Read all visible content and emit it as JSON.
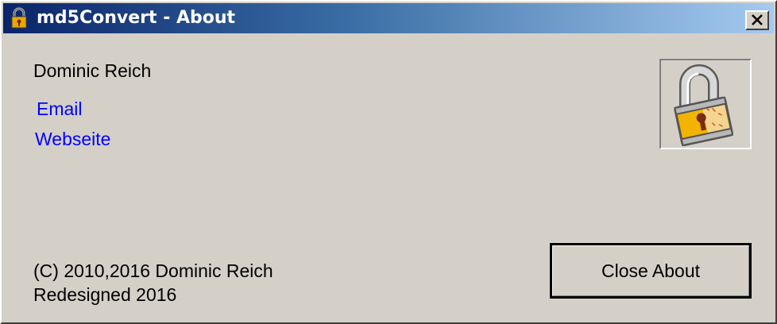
{
  "window": {
    "title": "md5Convert - About",
    "titlebar_gradient": [
      "#0a246a",
      "#a6caf0"
    ],
    "background": "#d4d0c8",
    "app_icon": "padlock-icon",
    "close_icon": "close-icon"
  },
  "about": {
    "author": "Dominic Reich",
    "links": {
      "email": "Email",
      "website": "Webseite",
      "link_color": "#0000ff"
    },
    "logo_icon": "padlock-icon",
    "copyright": "(C) 2010,2016 Dominic Reich",
    "redesigned": "Redesigned 2016"
  },
  "buttons": {
    "close_about": "Close About"
  }
}
